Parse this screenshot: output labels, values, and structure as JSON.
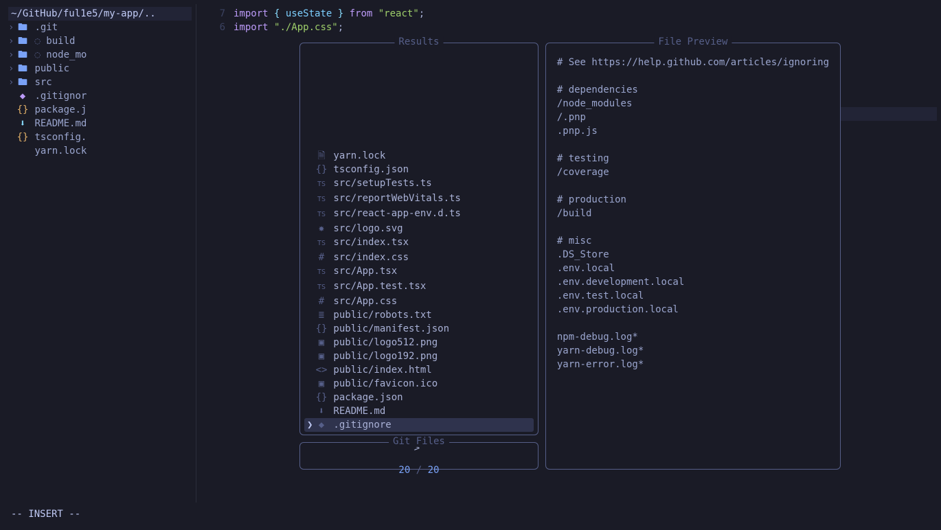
{
  "tree": {
    "header": "~/GitHub/ful1e5/my-app/..",
    "items": [
      {
        "chevron": "›",
        "icon": "folder",
        "label": ".git"
      },
      {
        "chevron": "›",
        "icon": "folder",
        "spinner": true,
        "label": "build"
      },
      {
        "chevron": "›",
        "icon": "folder",
        "spinner": true,
        "label": "node_mo"
      },
      {
        "chevron": "›",
        "icon": "folder",
        "label": "public"
      },
      {
        "chevron": "›",
        "icon": "folder",
        "label": "src"
      },
      {
        "chevron": " ",
        "icon": "config",
        "label": ".gitignor"
      },
      {
        "chevron": " ",
        "icon": "json",
        "label": "package.j"
      },
      {
        "chevron": " ",
        "icon": "md",
        "label": "README.md"
      },
      {
        "chevron": " ",
        "icon": "json",
        "label": "tsconfig."
      },
      {
        "chevron": " ",
        "icon": "none",
        "label": "yarn.lock"
      }
    ]
  },
  "code": {
    "lines": [
      {
        "n": "7",
        "tokens": [
          {
            "t": "import ",
            "c": "kw"
          },
          {
            "t": "{ ",
            "c": "punc"
          },
          {
            "t": "useState",
            "c": "fn"
          },
          {
            "t": " }",
            "c": "punc"
          },
          {
            "t": " from ",
            "c": "kw"
          },
          {
            "t": "\"react\"",
            "c": "str"
          },
          {
            "t": ";",
            "c": "plain"
          }
        ]
      },
      {
        "n": "6",
        "tokens": [
          {
            "t": "import ",
            "c": "kw"
          },
          {
            "t": "\"./App.css\"",
            "c": "str"
          },
          {
            "t": ";",
            "c": "plain"
          }
        ]
      }
    ]
  },
  "popup": {
    "results_title": "Results",
    "preview_title": "File Preview",
    "prompt_title": "Git Files",
    "count_current": "20",
    "count_sep": " / ",
    "count_total": "20",
    "prompt_symbol": ">",
    "items": [
      {
        "icon": "lock",
        "label": "yarn.lock"
      },
      {
        "icon": "json",
        "label": "tsconfig.json"
      },
      {
        "icon": "ts",
        "label": "src/setupTests.ts"
      },
      {
        "icon": "ts",
        "label": "src/reportWebVitals.ts"
      },
      {
        "icon": "ts",
        "label": "src/react-app-env.d.ts"
      },
      {
        "icon": "svg",
        "label": "src/logo.svg"
      },
      {
        "icon": "ts",
        "label": "src/index.tsx"
      },
      {
        "icon": "css",
        "label": "src/index.css"
      },
      {
        "icon": "ts",
        "label": "src/App.tsx"
      },
      {
        "icon": "ts",
        "label": "src/App.test.tsx"
      },
      {
        "icon": "css",
        "label": "src/App.css"
      },
      {
        "icon": "txt",
        "label": "public/robots.txt"
      },
      {
        "icon": "json",
        "label": "public/manifest.json"
      },
      {
        "icon": "png",
        "label": "public/logo512.png"
      },
      {
        "icon": "png",
        "label": "public/logo192.png"
      },
      {
        "icon": "html",
        "label": "public/index.html"
      },
      {
        "icon": "ico",
        "label": "public/favicon.ico"
      },
      {
        "icon": "json",
        "label": "package.json"
      },
      {
        "icon": "md",
        "label": "README.md"
      },
      {
        "icon": "config",
        "label": ".gitignore",
        "selected": true
      }
    ],
    "preview_text": "# See https://help.github.com/articles/ignoring\n\n# dependencies\n/node_modules\n/.pnp\n.pnp.js\n\n# testing\n/coverage\n\n# production\n/build\n\n# misc\n.DS_Store\n.env.local\n.env.development.local\n.env.test.local\n.env.production.local\n\nnpm-debug.log*\nyarn-debug.log*\nyarn-error.log*"
  },
  "status": {
    "mode": "-- INSERT --"
  },
  "icons": {
    "folder": "🖿",
    "json": "{}",
    "md": "⬇",
    "config": "◆",
    "ts": "TS",
    "css": "#",
    "svg": "✸",
    "png": "▣",
    "html": "<>",
    "txt": "≣",
    "ico": "▣",
    "lock": "🗎",
    "none": " "
  }
}
